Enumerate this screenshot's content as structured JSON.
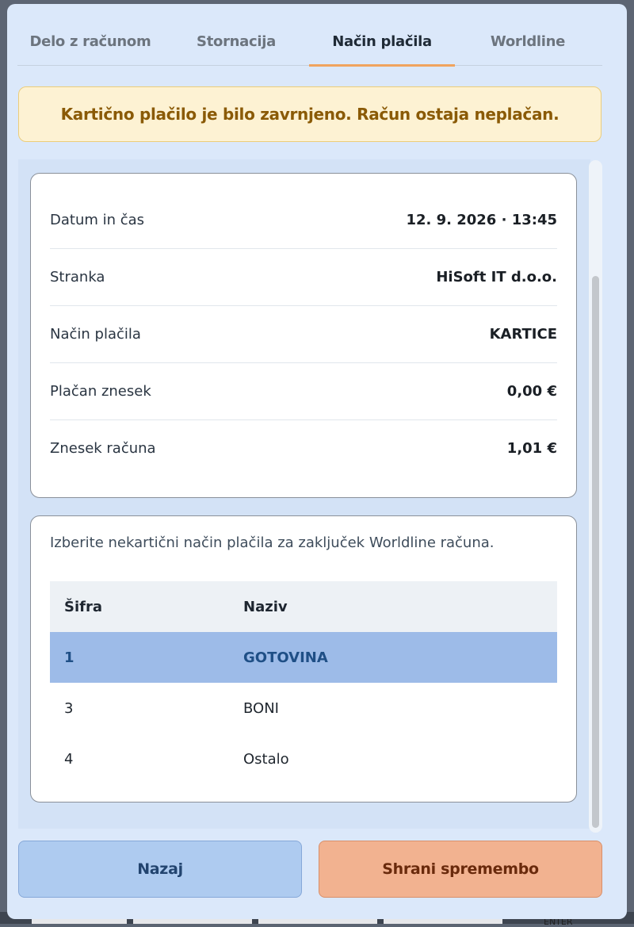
{
  "tabs": [
    {
      "label": "Delo z računom"
    },
    {
      "label": "Stornacija"
    },
    {
      "label": "Način plačila"
    },
    {
      "label": "Worldline"
    }
  ],
  "active_tab": "Način plačila",
  "alert": {
    "message": "Kartično plačilo je bilo zavrnjeno. Račun ostaja neplačan."
  },
  "details": {
    "rows": [
      {
        "label": "Datum in čas",
        "value": "12. 9. 2026 · 13:45"
      },
      {
        "label": "Stranka",
        "value": "HiSoft IT d.o.o."
      },
      {
        "label": "Način plačila",
        "value": "KARTICE"
      },
      {
        "label": "Plačan znesek",
        "value": "0,00 €"
      },
      {
        "label": "Znesek računa",
        "value": "1,01 €"
      }
    ]
  },
  "methods": {
    "caption": "Izberite nekartični način plačila za zaključek Worldline računa.",
    "columns": [
      "Šifra",
      "Naziv"
    ],
    "rows": [
      {
        "code": "1",
        "name": "GOTOVINA",
        "selected": true
      },
      {
        "code": "3",
        "name": "BONI",
        "selected": false
      },
      {
        "code": "4",
        "name": "Ostalo",
        "selected": false
      }
    ]
  },
  "buttons": {
    "back": "Nazaj",
    "save": "Shrani spremembo"
  },
  "background": {
    "key_label": "ENTER"
  },
  "colors": {
    "accent_tab": "#f0a35e",
    "alert_bg": "#fdf2d3",
    "alert_text": "#8a5a06",
    "selected_row": "#9dbbe8",
    "back_button": "#aecbf0",
    "save_button": "#f2b290"
  }
}
